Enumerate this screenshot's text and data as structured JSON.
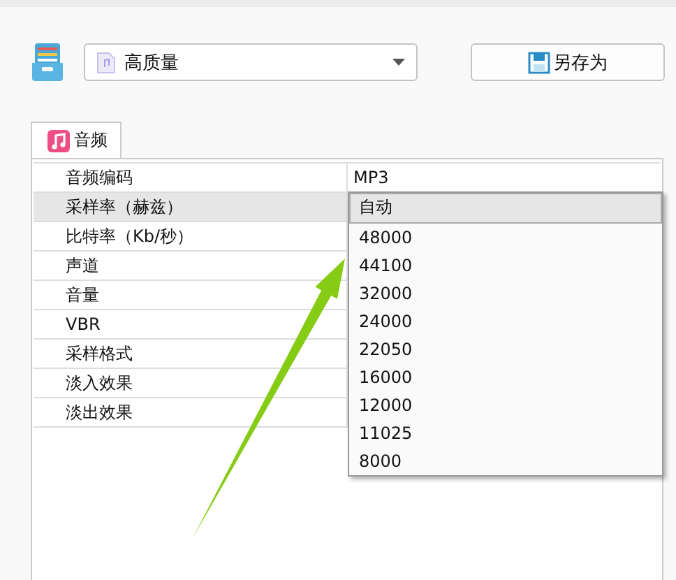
{
  "preset": {
    "value": "高质量"
  },
  "save_as_button": {
    "label": "另存为"
  },
  "tabs": [
    {
      "label": "音频",
      "selected": true
    }
  ],
  "properties": [
    {
      "name": "音频编码",
      "value": "MP3",
      "selected": false
    },
    {
      "name": "采样率（赫兹）",
      "selected": true
    },
    {
      "name": "比特率（Kb/秒）",
      "selected": false
    },
    {
      "name": "声道",
      "selected": false
    },
    {
      "name": "音量",
      "selected": false
    },
    {
      "name": "VBR",
      "selected": false
    },
    {
      "name": "采样格式",
      "selected": false
    },
    {
      "name": "淡入效果",
      "selected": false
    },
    {
      "name": "淡出效果",
      "selected": false
    }
  ],
  "dropdown_options": [
    {
      "label": "自动",
      "selected": true
    },
    {
      "label": "48000",
      "selected": false
    },
    {
      "label": "44100",
      "selected": false
    },
    {
      "label": "32000",
      "selected": false
    },
    {
      "label": "24000",
      "selected": false
    },
    {
      "label": "22050",
      "selected": false
    },
    {
      "label": "16000",
      "selected": false
    },
    {
      "label": "12000",
      "selected": false
    },
    {
      "label": "11025",
      "selected": false
    },
    {
      "label": "8000",
      "selected": false
    }
  ]
}
